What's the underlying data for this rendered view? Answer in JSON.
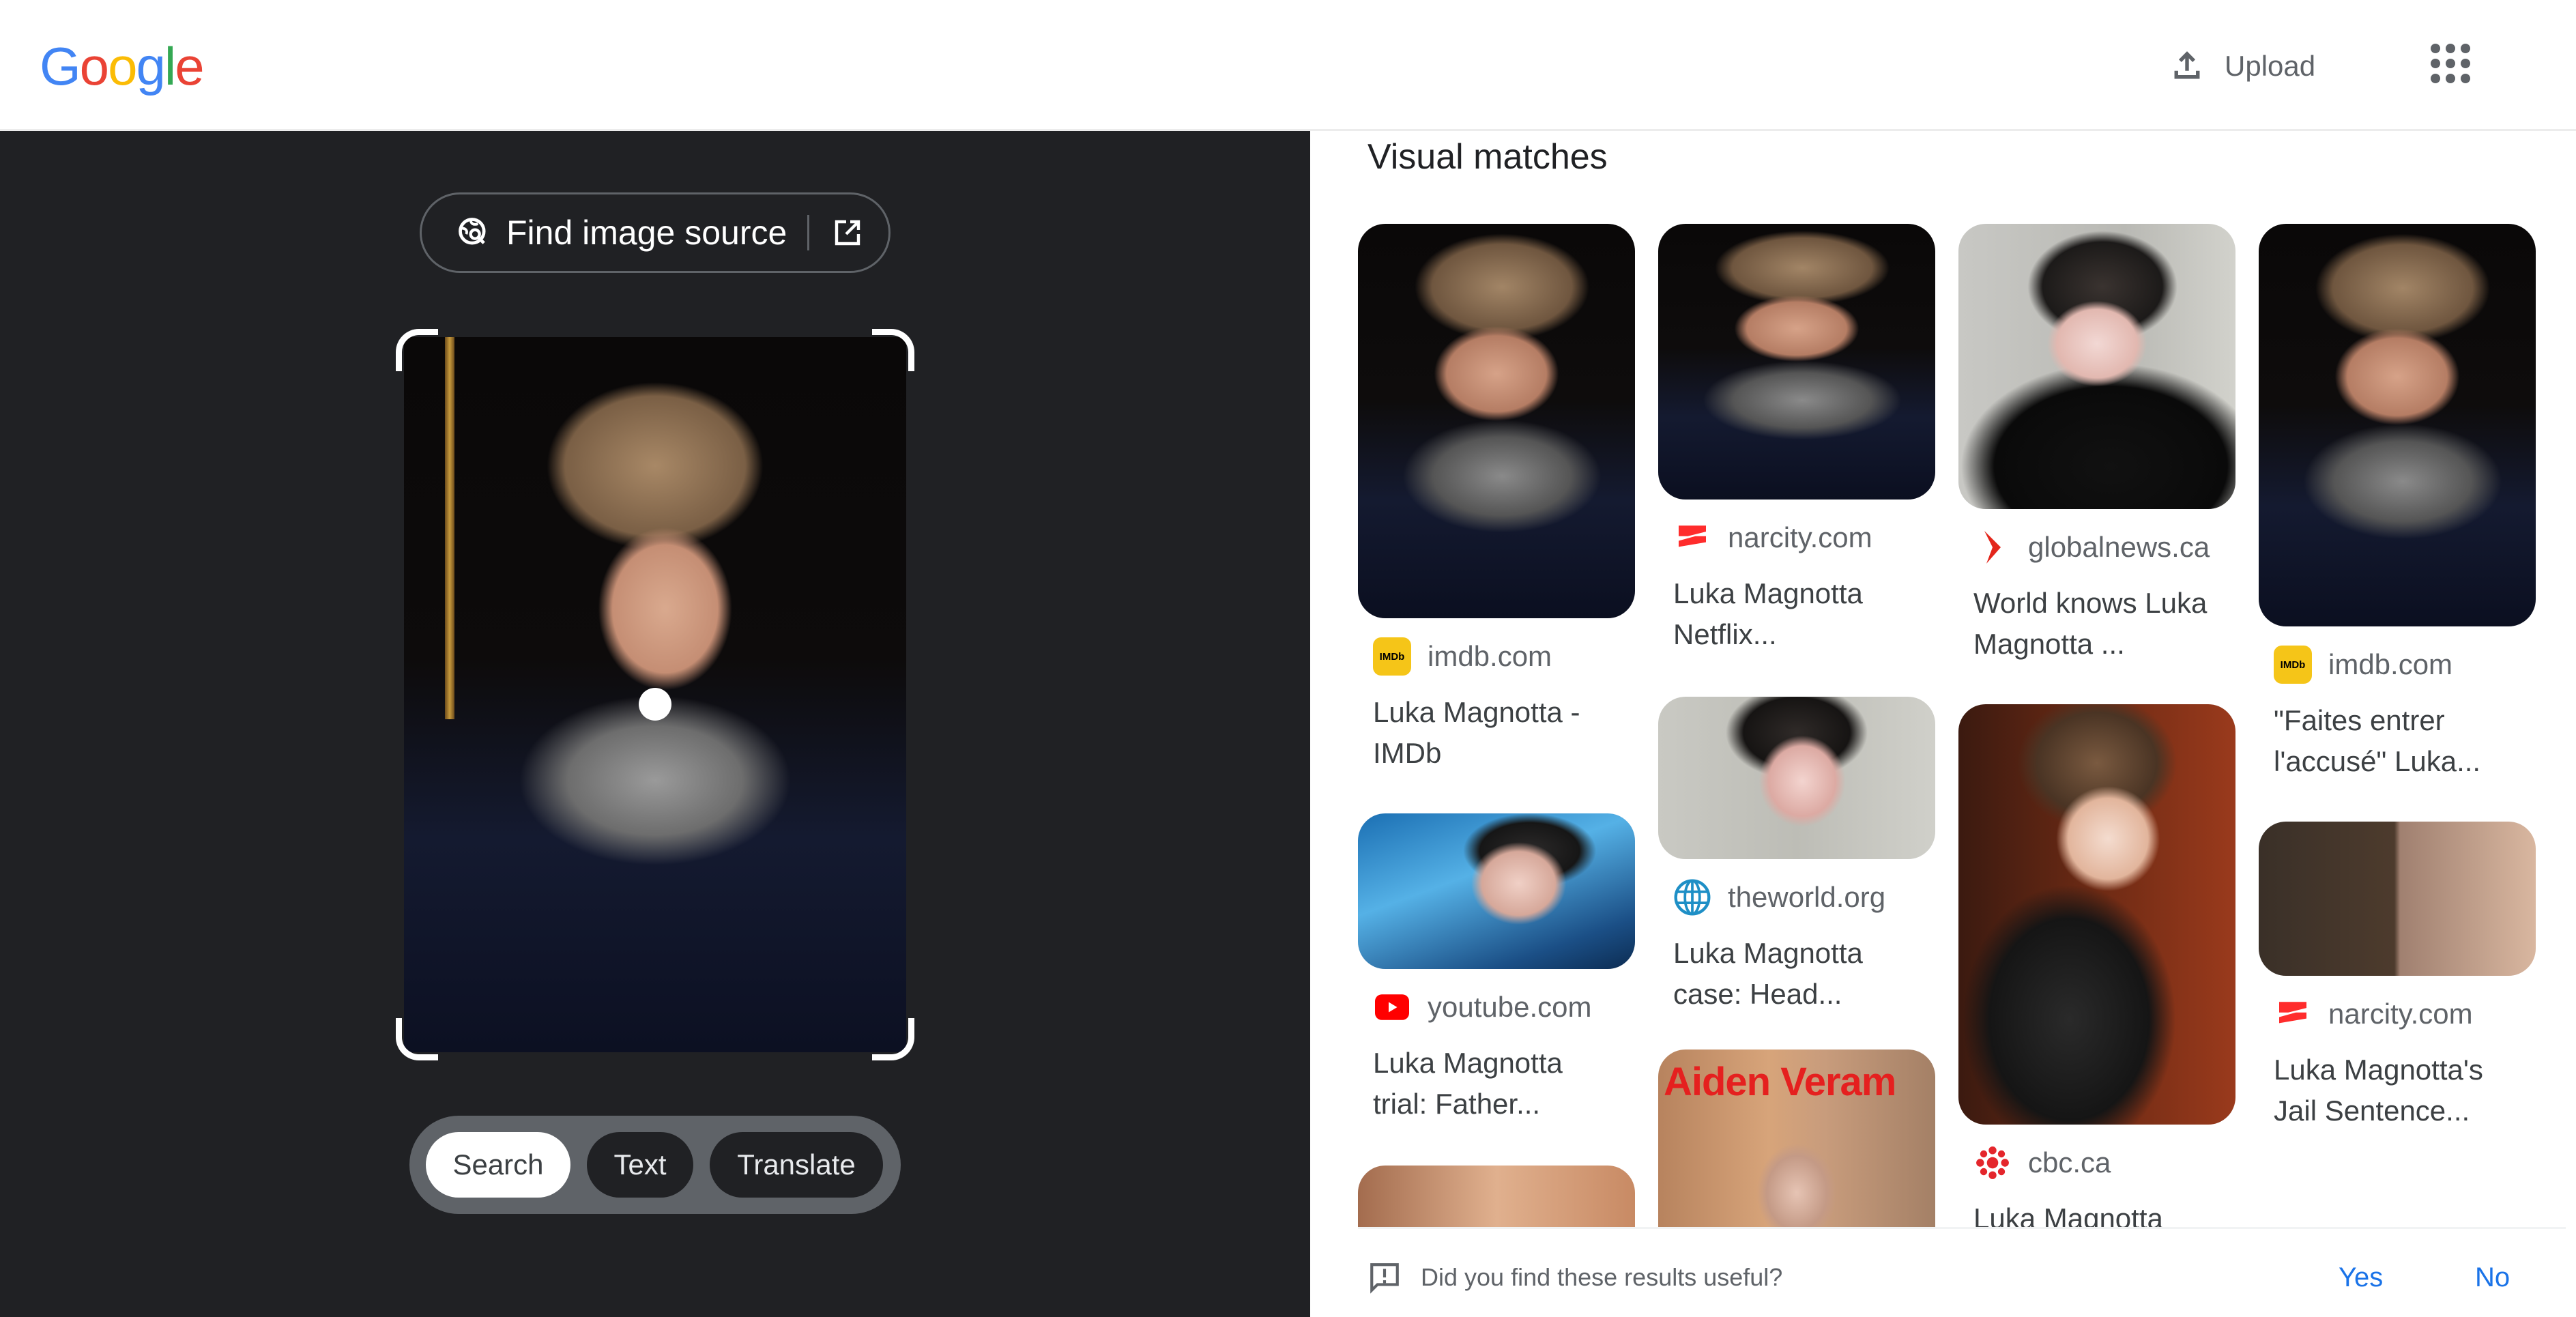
{
  "header": {
    "logo_letters": [
      {
        "char": "G",
        "color": "#4285f4"
      },
      {
        "char": "o",
        "color": "#ea4335"
      },
      {
        "char": "o",
        "color": "#fbbc05"
      },
      {
        "char": "g",
        "color": "#4285f4"
      },
      {
        "char": "l",
        "color": "#34a853"
      },
      {
        "char": "e",
        "color": "#ea4335"
      }
    ],
    "upload_label": "Upload",
    "upload_icon": "upload-icon",
    "apps_icon": "apps-grid-icon"
  },
  "lens_panel": {
    "find_source_label": "Find image source",
    "find_source_icon": "lens-search-icon",
    "open_external_icon": "open-in-new-icon",
    "modes": [
      {
        "label": "Search",
        "active": true
      },
      {
        "label": "Text",
        "active": false
      },
      {
        "label": "Translate",
        "active": false
      }
    ]
  },
  "results": {
    "section_title": "Visual matches",
    "columns": [
      [
        {
          "site": "imdb.com",
          "favicon": "imdb-favicon",
          "title": "Luka Magnotta - IMDb"
        },
        {
          "site": "youtube.com",
          "favicon": "youtube-favicon",
          "title": "Luka Magnotta trial: Father..."
        },
        {
          "site": "",
          "favicon": "",
          "title": ""
        }
      ],
      [
        {
          "site": "narcity.com",
          "favicon": "narcity-favicon",
          "title": "Luka Magnotta Netflix..."
        },
        {
          "site": "theworld.org",
          "favicon": "theworld-favicon",
          "title": "Luka Magnotta case: Head..."
        },
        {
          "site": "",
          "favicon": "",
          "title": "",
          "overlay_text": "Aiden Veram"
        }
      ],
      [
        {
          "site": "globalnews.ca",
          "favicon": "globalnews-favicon",
          "title": "World knows Luka Magnotta ..."
        },
        {
          "site": "cbc.ca",
          "favicon": "cbc-favicon",
          "title": "Luka Magnotta"
        }
      ],
      [
        {
          "site": "imdb.com",
          "favicon": "imdb-favicon",
          "title": "\"Faites entrer l'accusé\" Luka..."
        },
        {
          "site": "narcity.com",
          "favicon": "narcity-favicon",
          "title": "Luka Magnotta's Jail Sentence..."
        }
      ]
    ]
  },
  "feedback": {
    "question": "Did you find these results useful?",
    "yes_label": "Yes",
    "no_label": "No",
    "icon": "feedback-icon"
  },
  "colors": {
    "accent": "#1a73e8",
    "dark_panel": "#202124",
    "pill_bg": "#5f6368"
  }
}
